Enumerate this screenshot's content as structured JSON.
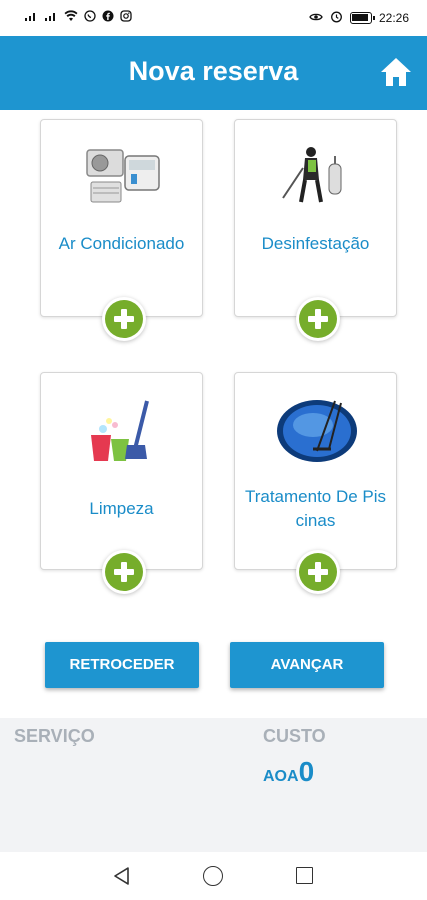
{
  "status_bar": {
    "signal_1": "⁴ᴳ",
    "signal_2": "⁴ᴳ",
    "icons_left": [
      "signal-icon",
      "signal-icon",
      "wifi-icon",
      "whatsapp-icon",
      "facebook-icon",
      "instagram-icon"
    ],
    "icons_right": [
      "eye-icon",
      "alarm-icon",
      "battery-icon"
    ],
    "time": "22:26"
  },
  "app_bar": {
    "title": "Nova reserva",
    "home_icon": "home-icon"
  },
  "services": [
    {
      "label": "Ar Condicionado",
      "icon": "air-conditioner-icon"
    },
    {
      "label": "Desinfestação",
      "icon": "disinfestation-icon"
    },
    {
      "label": "Limpeza",
      "icon": "cleaning-icon"
    },
    {
      "label": "Tratamento De Piscinas",
      "icon": "pool-icon"
    }
  ],
  "buttons": {
    "back": "RETROCEDER",
    "next": "AVANÇAR"
  },
  "summary": {
    "service_header": "SERVIÇO",
    "cost_header": "CUSTO",
    "currency": "AOA",
    "cost_value": "0"
  },
  "nav_bar": {
    "back_icon": "back-triangle-icon",
    "home_icon": "home-circle-icon",
    "recent_icon": "recent-square-icon"
  },
  "colors": {
    "primary": "#1e95d0",
    "accent_green": "#76ad2b",
    "label_blue": "#1a8cc8"
  }
}
